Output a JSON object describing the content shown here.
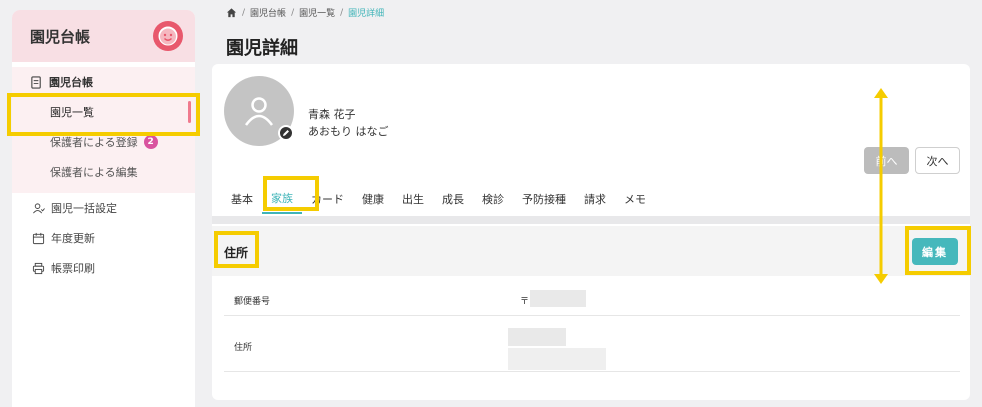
{
  "sidebar": {
    "title": "園児台帳",
    "group": {
      "label": "園児台帳",
      "items": [
        {
          "label": "園児一覧"
        },
        {
          "label": "保護者による登録",
          "badge": "2"
        },
        {
          "label": "保護者による編集"
        }
      ]
    },
    "items": [
      {
        "label": "園児一括設定"
      },
      {
        "label": "年度更新"
      },
      {
        "label": "帳票印刷"
      }
    ]
  },
  "breadcrumb": [
    "園児台帳",
    "園児一覧",
    "園児詳細"
  ],
  "page_title": "園児詳細",
  "child": {
    "name": "青森 花子",
    "kana": "あおもり はなご"
  },
  "nav": {
    "prev": "前へ",
    "next": "次へ"
  },
  "tabs": [
    "基本",
    "家族",
    "カード",
    "健康",
    "出生",
    "成長",
    "検診",
    "予防接種",
    "請求",
    "メモ"
  ],
  "active_tab": "家族",
  "section": {
    "title": "住所",
    "edit": "編集",
    "rows": [
      {
        "label": "郵便番号",
        "value": "〒"
      },
      {
        "label": "住所",
        "value": ""
      }
    ]
  },
  "colors": {
    "accent": "#46b8bc",
    "highlight": "#f5cc00",
    "brand": "#e8586c"
  }
}
